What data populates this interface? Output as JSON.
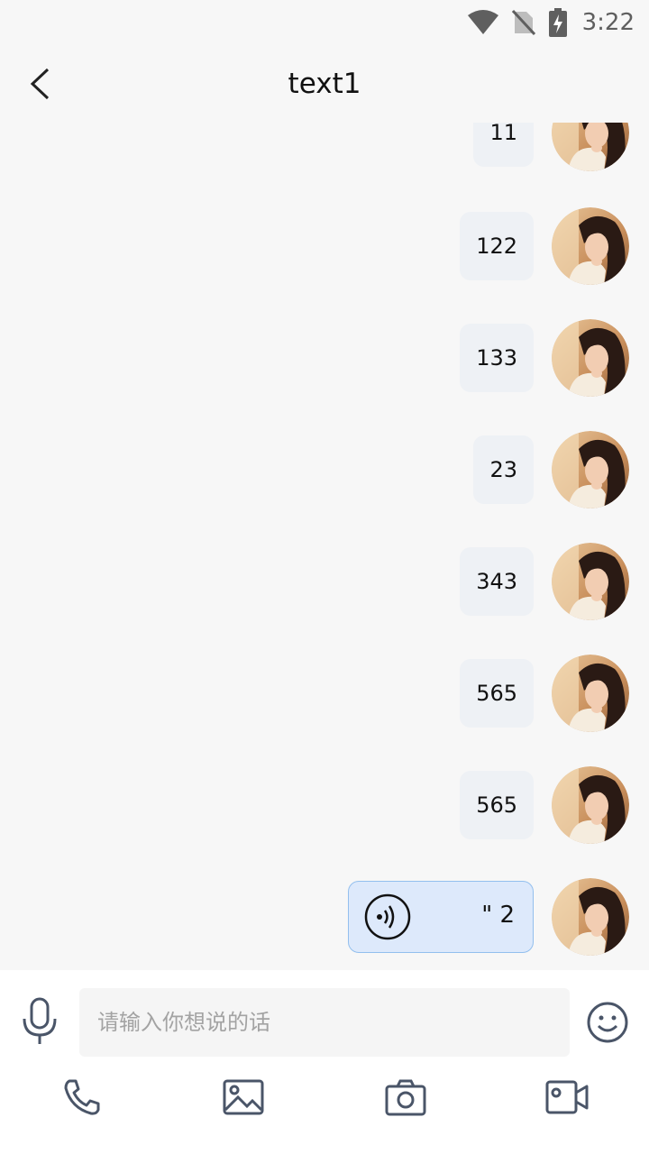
{
  "status_bar": {
    "time": "3:22",
    "icons": [
      "wifi-icon",
      "no-sim-icon",
      "battery-charging-icon"
    ]
  },
  "header": {
    "title": "text1",
    "back_icon": "chevron-left-icon"
  },
  "messages": [
    {
      "type": "text",
      "text": "11",
      "sender": "self"
    },
    {
      "type": "text",
      "text": "122",
      "sender": "self"
    },
    {
      "type": "text",
      "text": "133",
      "sender": "self"
    },
    {
      "type": "text",
      "text": "23",
      "sender": "self"
    },
    {
      "type": "text",
      "text": "343",
      "sender": "self"
    },
    {
      "type": "text",
      "text": "565",
      "sender": "self"
    },
    {
      "type": "text",
      "text": "565",
      "sender": "self"
    },
    {
      "type": "voice",
      "duration": "\" 2",
      "sender": "self"
    }
  ],
  "input": {
    "placeholder": "请输入你想说的话",
    "value": ""
  },
  "toolbar": {
    "icons": [
      "mic-icon",
      "emoji-icon",
      "phone-icon",
      "image-icon",
      "camera-icon",
      "video-icon"
    ]
  },
  "colors": {
    "background": "#f7f7f7",
    "bubble": "#eef1f5",
    "voice_bubble": "#dde9fb",
    "voice_border": "#93bfee",
    "icon": "#4a5568"
  }
}
